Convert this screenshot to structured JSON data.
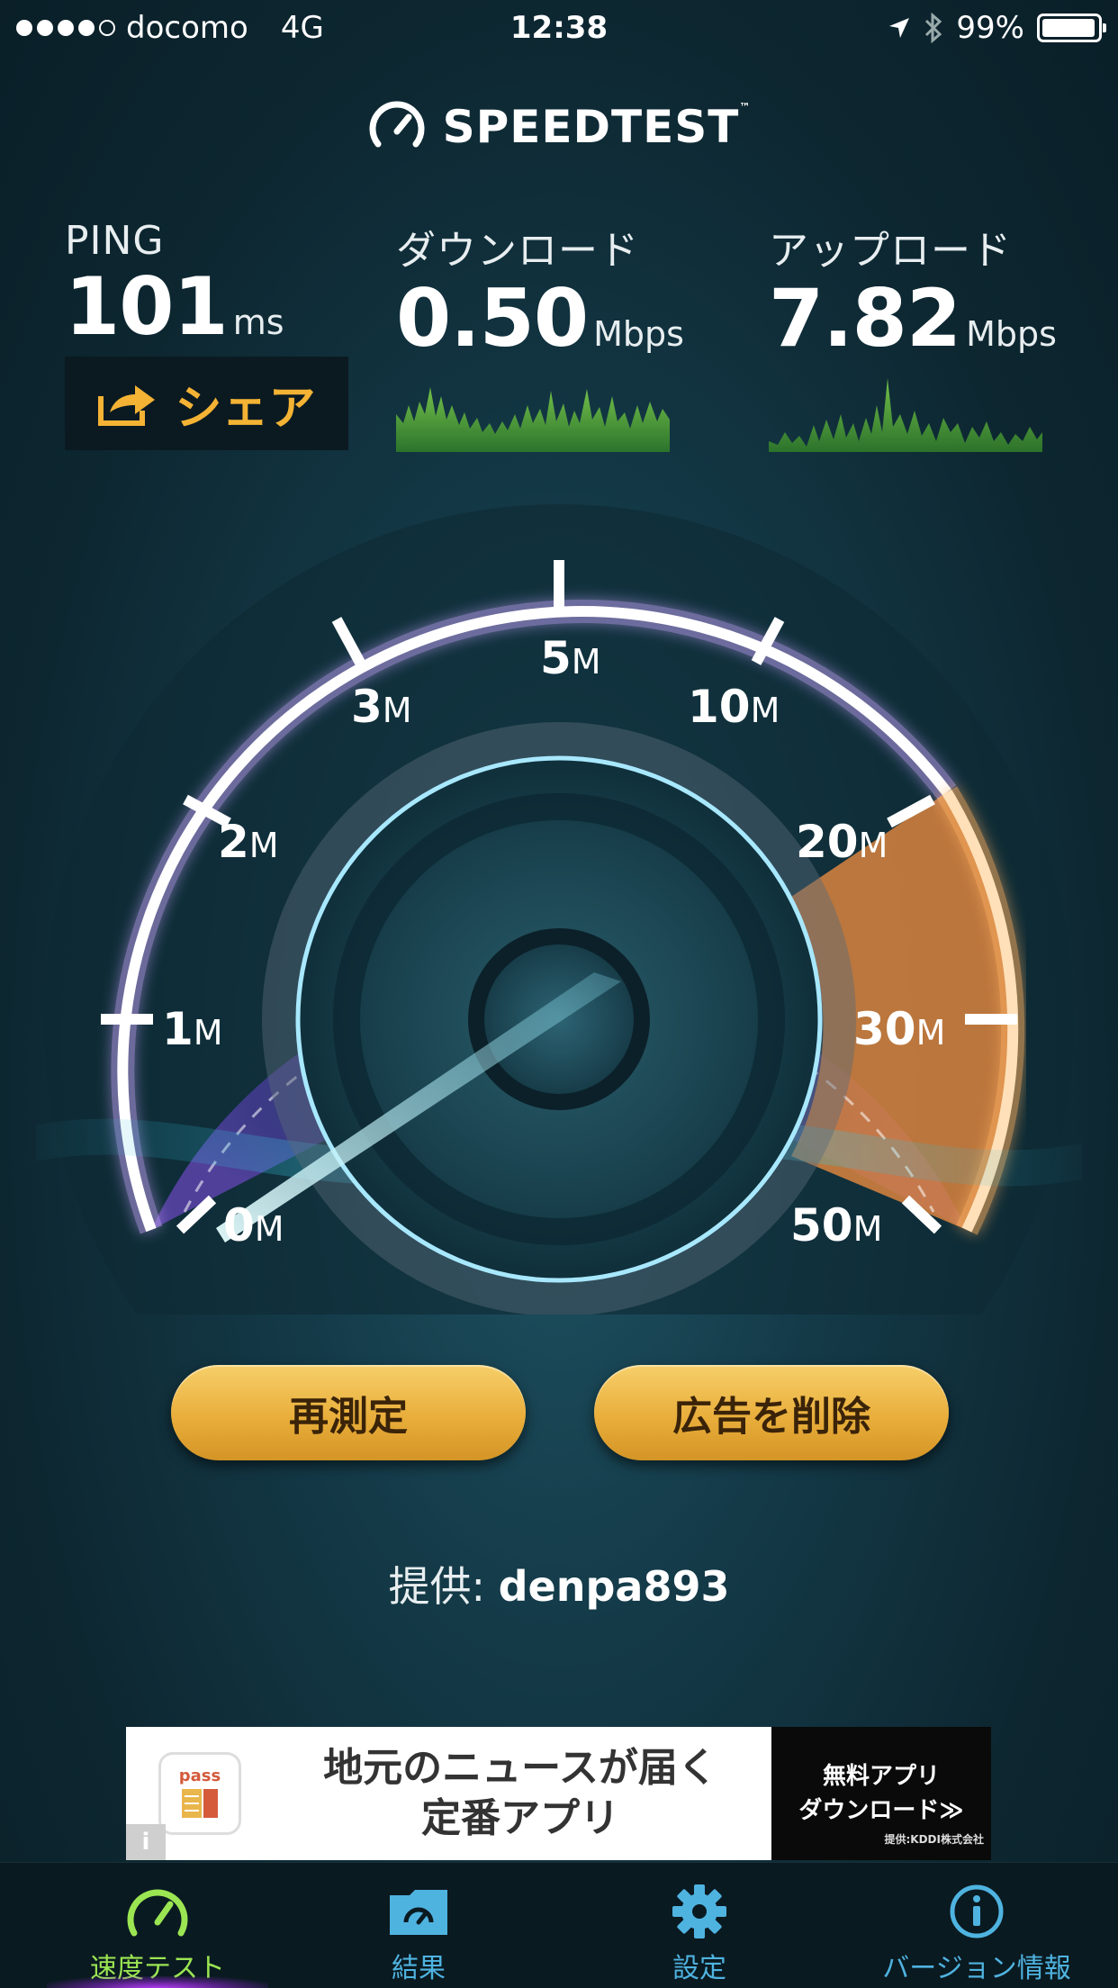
{
  "status_bar": {
    "carrier": "docomo",
    "network": "4G",
    "time": "12:38",
    "battery": "99%",
    "battery_level": 0.99,
    "signal_bars": 4
  },
  "header": {
    "title": "SPEEDTEST",
    "trademark": "™"
  },
  "stats": {
    "ping": {
      "label": "PING",
      "value": "101",
      "unit": "ms"
    },
    "download": {
      "label": "ダウンロード",
      "value": "0.50",
      "unit": "Mbps"
    },
    "upload": {
      "label": "アップロード",
      "value": "7.82",
      "unit": "Mbps"
    }
  },
  "share_button": {
    "label": "シェア"
  },
  "gauge": {
    "labels": [
      {
        "num": "0",
        "unit": "M"
      },
      {
        "num": "1",
        "unit": "M"
      },
      {
        "num": "2",
        "unit": "M"
      },
      {
        "num": "3",
        "unit": "M"
      },
      {
        "num": "5",
        "unit": "M"
      },
      {
        "num": "10",
        "unit": "M"
      },
      {
        "num": "20",
        "unit": "M"
      },
      {
        "num": "30",
        "unit": "M"
      },
      {
        "num": "50",
        "unit": "M"
      }
    ]
  },
  "buttons": {
    "retest": "再測定",
    "remove_ads": "広告を削除"
  },
  "provider": {
    "prefix": "提供:",
    "name": "denpa893"
  },
  "ad": {
    "app_icon_text": "pass",
    "headline_line1": "地元のニュースが届く",
    "headline_line2": "定番アプリ",
    "cta_line1": "無料アプリ",
    "cta_line2": "ダウンロード≫",
    "credit": "提供:KDDI株式会社",
    "info": "i"
  },
  "tabs": [
    {
      "label": "速度テスト",
      "icon": "speedometer-icon",
      "active": true
    },
    {
      "label": "結果",
      "icon": "results-folder-icon",
      "active": false
    },
    {
      "label": "設定",
      "icon": "gear-icon",
      "active": false
    },
    {
      "label": "バージョン情報",
      "icon": "info-icon",
      "active": false
    }
  ],
  "colors": {
    "accent_gold": "#f4b334",
    "tab_active": "#9be552",
    "tab_inactive": "#4fb3e0",
    "gauge_purple": "#4a3a8e",
    "gauge_orange": "#f0a040"
  }
}
